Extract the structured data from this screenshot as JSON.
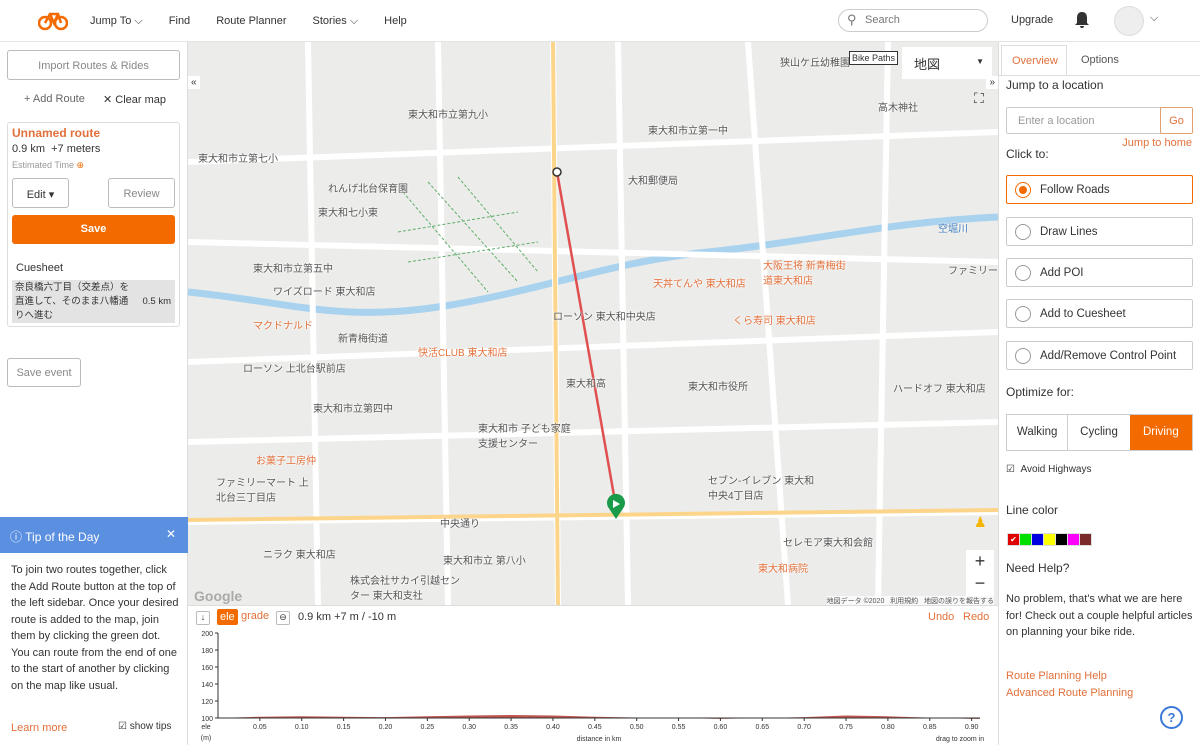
{
  "header": {
    "nav": [
      "Jump To",
      "Find",
      "Route Planner",
      "Stories",
      "Help"
    ],
    "search_placeholder": "Search",
    "upgrade": "Upgrade"
  },
  "left": {
    "import": "Import Routes & Rides",
    "add_route": "+ Add Route",
    "clear_map": "✕ Clear map",
    "route": {
      "name": "Unnamed route",
      "stats": "0.9 km  +7 meters",
      "estimated": "Estimated Time",
      "edit": "Edit",
      "review": "Review",
      "save": "Save",
      "cuesheet": "Cuesheet",
      "cue_text": "奈良橋六丁目（交差点）を直進して、そのまま八幡通りへ進む",
      "cue_dist": "0.5 km"
    },
    "save_event": "Save event",
    "tip": {
      "title": "Tip of the Day",
      "body": "To join two routes together, click the Add Route button at the top of the left sidebar. Once your desired route is added to the map, join them by clicking the green dot. You can route from the end of one to the start of another by clicking on the map like usual.",
      "learn_more": "Learn more",
      "show_tips": "show tips",
      "show_tips_checked": true
    }
  },
  "map": {
    "layer_toggle": "Bike Paths",
    "map_type": "地図",
    "google": "Google",
    "attribution": "地図データ ©2020   利用規約   地図の誤りを報告する",
    "labels": [
      "東大和市立第九小",
      "東大和市立第一中",
      "大和郵便局",
      "れんげ北台保育園",
      "東大和七小東",
      "東大和市立第五中",
      "空堀川",
      "ワイズロード 東大和店",
      "天丼てんや 東大和店",
      "大阪王将 新青梅街道東大和店",
      "マクドナルド",
      "新青梅街道",
      "快活CLUB 東大和店",
      "ローソン 東大和中央店",
      "くら寿司 東大和店",
      "ローソン 上北台駅前店",
      "東大和高",
      "東大和市役所",
      "ハードオフ 東大和店",
      "東大和市立第四中",
      "東大和市 子ども家庭支援センター",
      "お菓子工房仲",
      "ファミリーマート 上北台三丁目店",
      "セブン-イレブン 東大和中央4丁目店",
      "中央通り",
      "東大和市立 第八小",
      "東大和病院",
      "株式会社サカイ引越センター 東大和支社",
      "ニラク 東大和店",
      "セレモア東大和会館",
      "狭山ケ丘幼稚園",
      "高木神社",
      "東大和市立第七小",
      "ファミリーマート 和新青梅"
    ]
  },
  "elevation": {
    "ele": "ele",
    "grade": "grade",
    "summary": "0.9 km +7 m / -10 m",
    "undo": "Undo",
    "redo": "Redo",
    "ylabel": "ele",
    "yunit": "(m)",
    "xlabel": "distance in km",
    "hint": "drag to zoom in",
    "yticks": [
      "200",
      "180",
      "160",
      "140",
      "120",
      "100"
    ],
    "xticks": [
      "0.05",
      "0.10",
      "0.15",
      "0.20",
      "0.25",
      "0.30",
      "0.35",
      "0.40",
      "0.45",
      "0.50",
      "0.55",
      "0.60",
      "0.65",
      "0.70",
      "0.75",
      "0.80",
      "0.85",
      "0.90"
    ],
    "profile": {
      "x": [
        0,
        0.05,
        0.1,
        0.15,
        0.2,
        0.25,
        0.3,
        0.35,
        0.4,
        0.45,
        0.5,
        0.55,
        0.6,
        0.65,
        0.7,
        0.75,
        0.8,
        0.85,
        0.9
      ],
      "y": [
        100,
        101.5,
        102,
        101.5,
        101,
        102,
        103,
        103.5,
        103,
        101.5,
        100.5,
        100,
        99,
        100,
        101,
        103,
        102,
        100.5,
        99
      ]
    },
    "fill_color": "#b5362f"
  },
  "right": {
    "tabs": [
      "Overview",
      "Options"
    ],
    "jump_title": "Jump to a location",
    "location_placeholder": "Enter a location",
    "go": "Go",
    "jump_home": "Jump to home",
    "click_to": "Click to:",
    "click_options": [
      "Follow Roads",
      "Draw Lines",
      "Add POI",
      "Add to Cuesheet",
      "Add/Remove Control Point"
    ],
    "selected_option": "Follow Roads",
    "optimize_title": "Optimize for:",
    "optimize": [
      "Walking",
      "Cycling",
      "Driving"
    ],
    "optimize_selected": "Driving",
    "avoid_highways": "Avoid Highways",
    "avoid_checked": true,
    "line_color_title": "Line color",
    "line_colors": [
      "#e00000",
      "#00e000",
      "#0000e0",
      "#ffff00",
      "#000000",
      "#ff00ff",
      "#7a2a2a"
    ],
    "line_color_selected": "#e00000",
    "help_title": "Need Help?",
    "help_text": "No problem, that's what we are here for! Check out a couple helpful articles on planning your bike ride.",
    "links": [
      "Route Planning Help",
      "Advanced Route Planning"
    ]
  },
  "colors": {
    "accent": "#f26a00",
    "route": "#e05050",
    "tip": "#5b8fe0"
  }
}
